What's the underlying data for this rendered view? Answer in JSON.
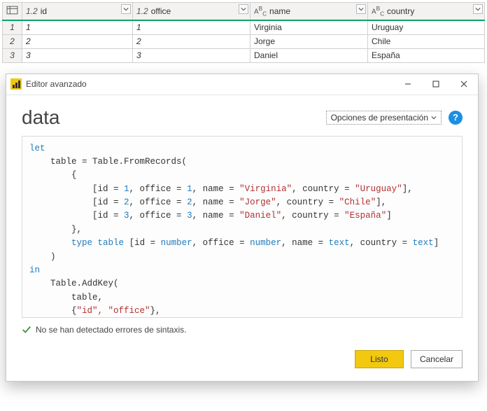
{
  "grid": {
    "columns": [
      {
        "name": "id",
        "typeLabel": "1.2",
        "kind": "number"
      },
      {
        "name": "office",
        "typeLabel": "1.2",
        "kind": "number"
      },
      {
        "name": "name",
        "typeLabel": "ABC",
        "kind": "text"
      },
      {
        "name": "country",
        "typeLabel": "ABC",
        "kind": "text"
      }
    ],
    "rows": [
      {
        "n": "1",
        "id": "1",
        "office": "1",
        "name": "Virginia",
        "country": "Uruguay"
      },
      {
        "n": "2",
        "id": "2",
        "office": "2",
        "name": "Jorge",
        "country": "Chile"
      },
      {
        "n": "3",
        "id": "3",
        "office": "3",
        "name": "Daniel",
        "country": "España"
      }
    ]
  },
  "dialog": {
    "title": "Editor avanzado",
    "queryName": "data",
    "displayOptionsLabel": "Opciones de presentación",
    "status": "No se han detectado errores de sintaxis.",
    "buttons": {
      "done": "Listo",
      "cancel": "Cancelar"
    },
    "code": {
      "rec1": {
        "name": "Virginia",
        "country": "Uruguay"
      },
      "rec2": {
        "name": "Jorge",
        "country": "Chile"
      },
      "rec3": {
        "name": "Daniel",
        "country": "España"
      },
      "keyCols": "\"id\", \"office\""
    }
  }
}
